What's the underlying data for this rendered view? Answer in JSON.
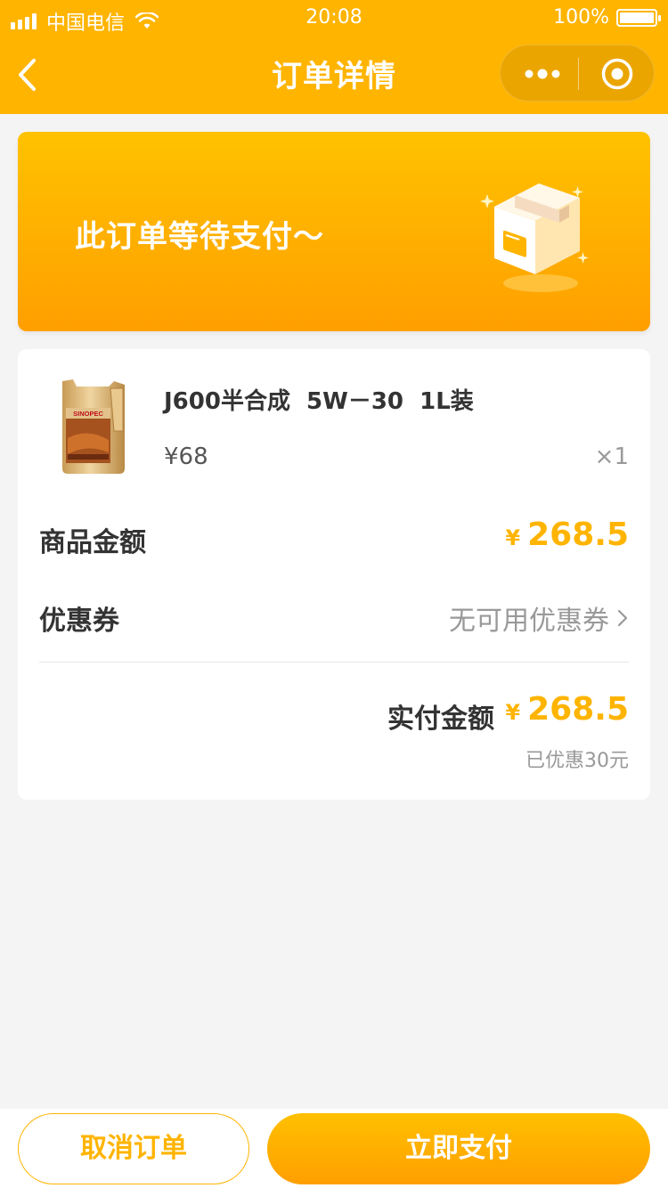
{
  "status_bar": {
    "carrier": "中国电信",
    "time": "20:08",
    "battery": "100%"
  },
  "nav": {
    "title": "订单详情",
    "back_icon": "chevron-left-icon",
    "more_icon": "more-dots-icon",
    "close_icon": "target-icon"
  },
  "banner": {
    "text": "此订单等待支付～",
    "illustration": "package-box-icon"
  },
  "product": {
    "name": "J600半合成  5W－30  1L装",
    "price": "¥68",
    "quantity": "×1",
    "image_brand": "SINOPEC"
  },
  "summary": {
    "goods_amount_label": "商品金额",
    "goods_amount_currency": "¥",
    "goods_amount_value": "268.5",
    "coupon_label": "优惠券",
    "coupon_value": "无可用优惠券",
    "total_label": "实付金额",
    "total_currency": "¥",
    "total_value": "268.5",
    "discount_note": "已优惠30元"
  },
  "actions": {
    "cancel_label": "取消订单",
    "pay_label": "立即支付"
  },
  "colors": {
    "accent": "#ffb400",
    "background": "#f4f4f4"
  }
}
